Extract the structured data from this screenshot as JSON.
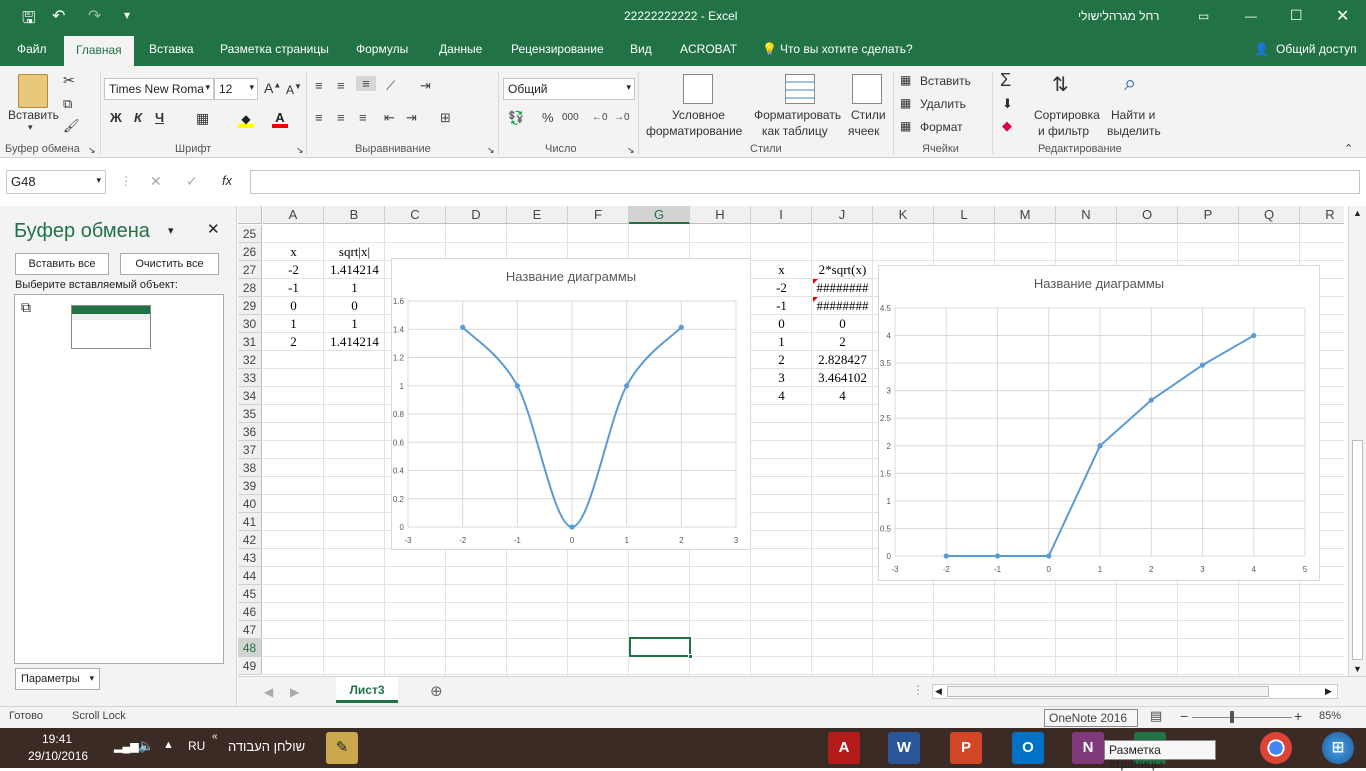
{
  "titlebar": {
    "doc_title": "22222222222  -  Excel",
    "user": "רחל מגרהלישולי"
  },
  "tabs": [
    "Файл",
    "Главная",
    "Вставка",
    "Разметка страницы",
    "Формулы",
    "Данные",
    "Рецензирование",
    "Вид",
    "ACROBAT",
    "Что вы хотите сделать?"
  ],
  "share_label": "Общий доступ",
  "ribbon": {
    "clipboard": {
      "paste": "Вставить",
      "label": "Буфер обмена"
    },
    "font": {
      "name": "Times New Roma",
      "size": "12",
      "bold": "Ж",
      "italic": "К",
      "underline": "Ч",
      "label": "Шрифт"
    },
    "alignment": {
      "label": "Выравнивание"
    },
    "number": {
      "format": "Общий",
      "label": "Число"
    },
    "styles": {
      "cond1": "Условное",
      "cond2": "форматирование",
      "table1": "Форматировать",
      "table2": "как таблицу",
      "cell1": "Стили",
      "cell2": "ячеек",
      "label": "Стили"
    },
    "cells": {
      "insert": "Вставить",
      "delete": "Удалить",
      "format": "Формат",
      "label": "Ячейки"
    },
    "editing": {
      "sort1": "Сортировка",
      "sort2": "и фильтр",
      "find1": "Найти и",
      "find2": "выделить",
      "label": "Редактирование"
    }
  },
  "formula_bar": {
    "name_box": "G48",
    "formula": ""
  },
  "clipboard_panel": {
    "title": "Буфер обмена",
    "paste_all": "Вставить все",
    "clear_all": "Очистить все",
    "prompt": "Выберите вставляемый объект:",
    "params": "Параметры"
  },
  "columns": [
    "A",
    "B",
    "C",
    "D",
    "E",
    "F",
    "G",
    "H",
    "I",
    "J",
    "K",
    "L",
    "M",
    "N",
    "O",
    "P",
    "Q",
    "R"
  ],
  "rows": [
    "25",
    "26",
    "27",
    "28",
    "29",
    "30",
    "31",
    "32",
    "33",
    "34",
    "35",
    "36",
    "37",
    "38",
    "39",
    "40",
    "41",
    "42",
    "43",
    "44",
    "45",
    "46",
    "47",
    "48",
    "49"
  ],
  "table1": {
    "headers": [
      "x",
      "sqrt|x|"
    ],
    "rows": [
      [
        "-2",
        "1.414214"
      ],
      [
        "-1",
        "1"
      ],
      [
        "0",
        "0"
      ],
      [
        "1",
        "1"
      ],
      [
        "2",
        "1.414214"
      ]
    ]
  },
  "table2": {
    "headers": [
      "x",
      "2*sqrt(x)"
    ],
    "rows": [
      [
        "-2",
        "########"
      ],
      [
        "-1",
        "########"
      ],
      [
        "0",
        "0"
      ],
      [
        "1",
        "2"
      ],
      [
        "2",
        "2.828427"
      ],
      [
        "3",
        "3.464102"
      ],
      [
        "4",
        "4"
      ]
    ]
  },
  "chart_data": [
    {
      "type": "line",
      "title": "Название диаграммы",
      "smooth": true,
      "x": [
        -2,
        -1,
        0,
        1,
        2
      ],
      "y": [
        1.414214,
        1,
        0,
        1,
        1.414214
      ],
      "xlim": [
        -3,
        3
      ],
      "ylim": [
        0,
        1.6
      ],
      "xticks": [
        "-3",
        "-2",
        "-1",
        "0",
        "1",
        "2",
        "3"
      ],
      "yticks": [
        "0",
        "0.2",
        "0.4",
        "0.6",
        "0.8",
        "1",
        "1.2",
        "1.4",
        "1.6"
      ],
      "grid": true,
      "color": "#5b9bd5"
    },
    {
      "type": "line",
      "title": "Название диаграммы",
      "smooth": false,
      "x": [
        -2,
        -1,
        0,
        1,
        2,
        3,
        4
      ],
      "y": [
        0,
        0,
        0,
        2,
        2.828427,
        3.464102,
        4
      ],
      "xlim": [
        -3,
        5
      ],
      "ylim": [
        0,
        4.5
      ],
      "xticks": [
        "-3",
        "-2",
        "-1",
        "0",
        "1",
        "2",
        "3",
        "4",
        "5"
      ],
      "yticks": [
        "0",
        "0.5",
        "1",
        "1.5",
        "2",
        "2.5",
        "3",
        "3.5",
        "4",
        "4.5"
      ],
      "grid": true,
      "color": "#5b9bd5"
    }
  ],
  "sheet_tab": "Лист3",
  "status": {
    "ready": "Готово",
    "scroll_lock": "Scroll Lock",
    "zoom": "85%",
    "tooltip": "OneNote 2016"
  },
  "taskbar": {
    "time": "19:41",
    "date": "29/10/2016",
    "lang": "RU",
    "desktop": "שולחן העבודה",
    "tooltip": "Разметка страницы"
  }
}
